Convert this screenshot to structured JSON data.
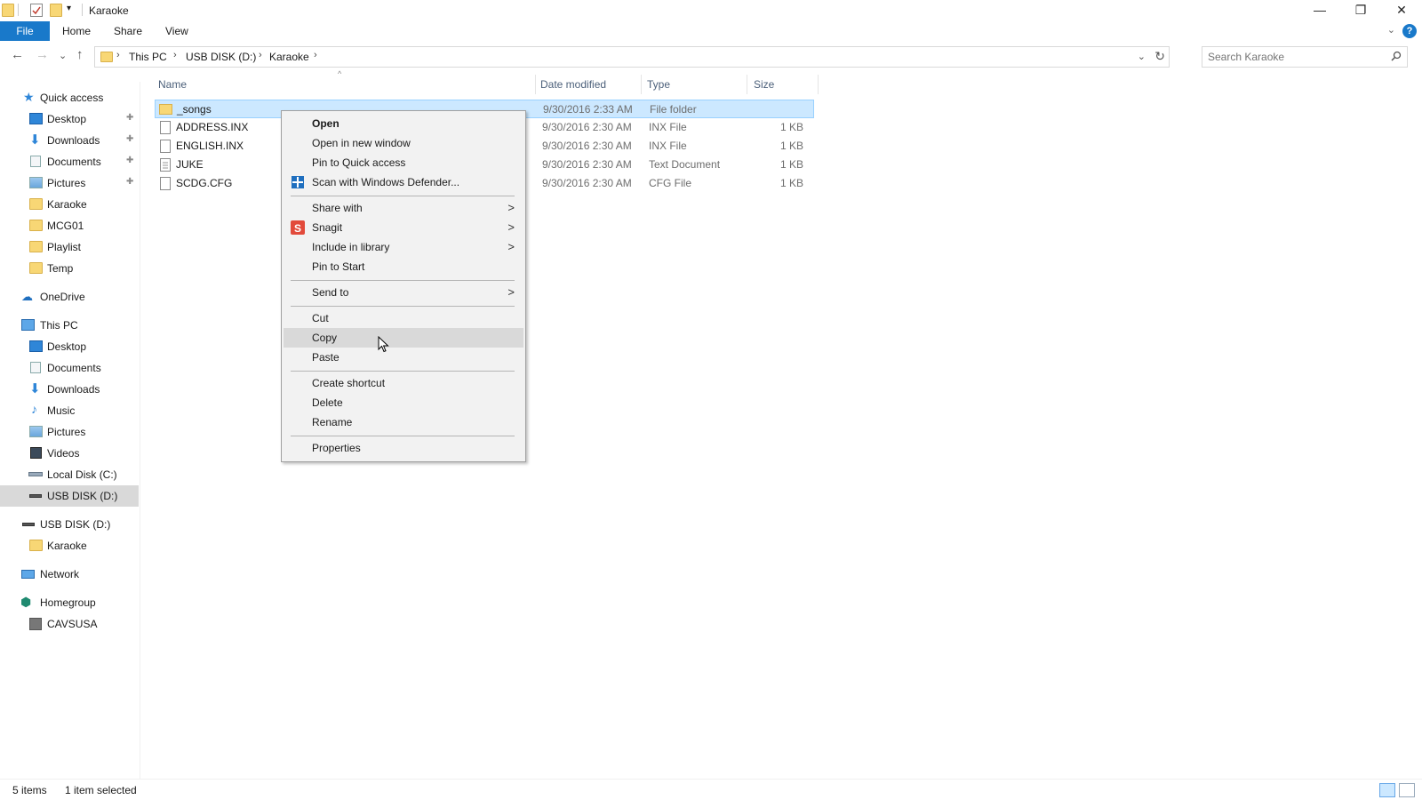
{
  "window": {
    "title": "Karaoke",
    "minimize": "—",
    "restore": "❐",
    "close": "✕"
  },
  "ribbon": {
    "tabs": [
      "File",
      "Home",
      "Share",
      "View"
    ],
    "help": "?",
    "expand": "⌄"
  },
  "nav": {
    "back": "←",
    "forward": "→",
    "recent": "⌄",
    "up": "↑",
    "breadcrumb": [
      "This PC",
      "USB DISK (D:)",
      "Karaoke"
    ],
    "separator": "›",
    "dropdown": "⌄",
    "refresh": "↻"
  },
  "search": {
    "placeholder": "Search Karaoke"
  },
  "navpane": {
    "quick_access": {
      "label": "Quick access",
      "items": [
        {
          "label": "Desktop",
          "pinned": true
        },
        {
          "label": "Downloads",
          "pinned": true
        },
        {
          "label": "Documents",
          "pinned": true
        },
        {
          "label": "Pictures",
          "pinned": true
        },
        {
          "label": "Karaoke",
          "pinned": false
        },
        {
          "label": "MCG01",
          "pinned": false
        },
        {
          "label": "Playlist",
          "pinned": false
        },
        {
          "label": "Temp",
          "pinned": false
        }
      ]
    },
    "onedrive": "OneDrive",
    "this_pc": {
      "label": "This PC",
      "items": [
        "Desktop",
        "Documents",
        "Downloads",
        "Music",
        "Pictures",
        "Videos",
        "Local Disk (C:)",
        "USB DISK (D:)"
      ]
    },
    "usb": {
      "label": "USB DISK (D:)",
      "items": [
        "Karaoke"
      ]
    },
    "network": "Network",
    "homegroup": {
      "label": "Homegroup",
      "items": [
        "CAVSUSA"
      ]
    },
    "pin_glyph": "📌"
  },
  "columns": {
    "name": "Name",
    "date": "Date modified",
    "type": "Type",
    "size": "Size",
    "sort_arrow": "^"
  },
  "files": [
    {
      "name": "_songs",
      "date": "9/30/2016 2:33 AM",
      "type": "File folder",
      "size": "",
      "kind": "folder",
      "selected": true
    },
    {
      "name": "ADDRESS.INX",
      "date": "9/30/2016 2:30 AM",
      "type": "INX File",
      "size": "1 KB",
      "kind": "file",
      "selected": false
    },
    {
      "name": "ENGLISH.INX",
      "date": "9/30/2016 2:30 AM",
      "type": "INX File",
      "size": "1 KB",
      "kind": "file",
      "selected": false
    },
    {
      "name": "JUKE",
      "date": "9/30/2016 2:30 AM",
      "type": "Text Document",
      "size": "1 KB",
      "kind": "text",
      "selected": false
    },
    {
      "name": "SCDG.CFG",
      "date": "9/30/2016 2:30 AM",
      "type": "CFG File",
      "size": "1 KB",
      "kind": "file",
      "selected": false
    }
  ],
  "context_menu": {
    "items": [
      {
        "label": "Open",
        "bold": true
      },
      {
        "label": "Open in new window"
      },
      {
        "label": "Pin to Quick access"
      },
      {
        "label": "Scan with Windows Defender...",
        "icon": "defender-icon"
      },
      {
        "separator": true
      },
      {
        "label": "Share with",
        "submenu": true
      },
      {
        "label": "Snagit",
        "submenu": true,
        "icon": "snagit-icon"
      },
      {
        "label": "Include in library",
        "submenu": true
      },
      {
        "label": "Pin to Start"
      },
      {
        "separator": true
      },
      {
        "label": "Send to",
        "submenu": true
      },
      {
        "separator": true
      },
      {
        "label": "Cut"
      },
      {
        "label": "Copy",
        "hover": true
      },
      {
        "label": "Paste"
      },
      {
        "separator": true
      },
      {
        "label": "Create shortcut"
      },
      {
        "label": "Delete"
      },
      {
        "label": "Rename"
      },
      {
        "separator": true
      },
      {
        "label": "Properties"
      }
    ],
    "submenu_arrow": ">"
  },
  "status": {
    "item_count": "5 items",
    "selection": "1 item selected"
  },
  "colors": {
    "accent": "#1979ca",
    "selection": "#cce8ff",
    "selection_border": "#99d1ff",
    "menu_bg": "#f2f2f2",
    "folder": "#f8d775"
  }
}
